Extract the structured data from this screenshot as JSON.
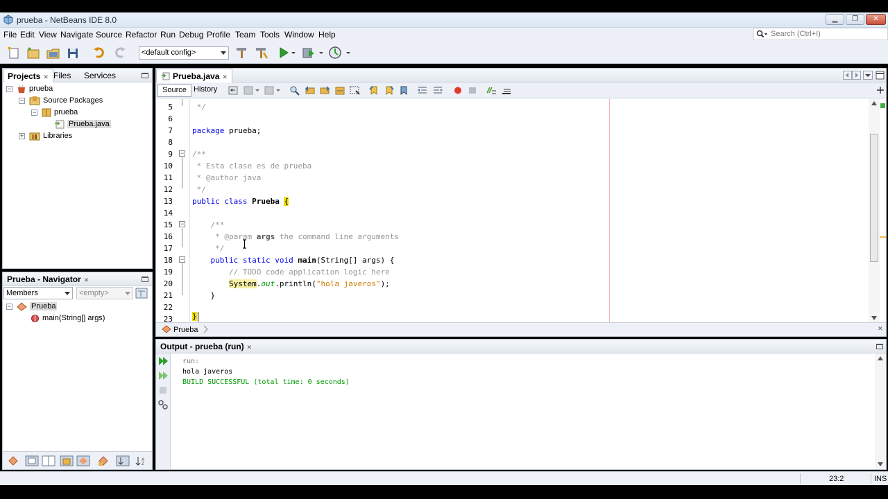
{
  "window": {
    "title": "prueba - NetBeans IDE 8.0",
    "minimize": "▁",
    "maximize": "❐",
    "close": "✕"
  },
  "menu": [
    "File",
    "Edit",
    "View",
    "Navigate",
    "Source",
    "Refactor",
    "Run",
    "Debug",
    "Profile",
    "Team",
    "Tools",
    "Window",
    "Help"
  ],
  "search": {
    "placeholder": "Search (Ctrl+I)"
  },
  "toolbar": {
    "config_value": "<default config>"
  },
  "projects_panel": {
    "tabs": [
      "Projects",
      "Files",
      "Services"
    ],
    "tree": [
      {
        "label": "prueba",
        "icon": "project-icon"
      },
      {
        "label": "Source Packages",
        "icon": "source-packages-icon"
      },
      {
        "label": "prueba",
        "icon": "package-icon"
      },
      {
        "label": "Prueba.java",
        "icon": "java-file-icon"
      },
      {
        "label": "Libraries",
        "icon": "libraries-icon"
      }
    ]
  },
  "navigator_panel": {
    "title": "Prueba - Navigator",
    "filter_value": "Members",
    "scope_value": "<empty>",
    "tree": [
      {
        "label": "Prueba",
        "icon": "class-icon"
      },
      {
        "label": "main(String[] args)",
        "icon": "method-icon"
      }
    ]
  },
  "editor": {
    "file_tab": "Prueba.java",
    "source_tab": "Source",
    "history_tab": "History",
    "line_numbers": [
      "5",
      "6",
      "7",
      "8",
      "9",
      "10",
      "11",
      "12",
      "13",
      "14",
      "15",
      "16",
      "17",
      "18",
      "19",
      "20",
      "21",
      "22",
      "23"
    ],
    "code": {
      "l5": " */",
      "l7a": "package",
      "l7b": " prueba;",
      "l9": "/**",
      "l10": " * Esta clase es de prueba",
      "l11": " * @author java",
      "l12": " */",
      "l13a": "public class",
      "l13b": " Prueba ",
      "l13c": "{",
      "l15": "    /**",
      "l16a": "     * @param ",
      "l16b": "args",
      "l16c": " the command line arguments",
      "l17": "     */",
      "l18a": "    public static void",
      "l18b": " main",
      "l18c": "(String[] args) {",
      "l19": "        // TODO code application logic here",
      "l20a": "        ",
      "l20b": "System",
      "l20c": ".",
      "l20d": "out",
      "l20e": ".println(",
      "l20f": "\"hola javeros\"",
      "l20g": ");",
      "l21": "    }",
      "l23": "}"
    },
    "breadcrumb": "Prueba"
  },
  "output_panel": {
    "title": "Output - prueba (run)",
    "lines": [
      "run:",
      "hola javeros",
      "BUILD SUCCESSFUL (total time: 0 seconds)"
    ]
  },
  "status": {
    "position": "23:2",
    "mode": "INS"
  },
  "colors": {
    "keyword": "#0000e6",
    "comment": "#969696",
    "string": "#ce7b00",
    "success": "#009900",
    "brace_highlight": "#f0e000"
  }
}
